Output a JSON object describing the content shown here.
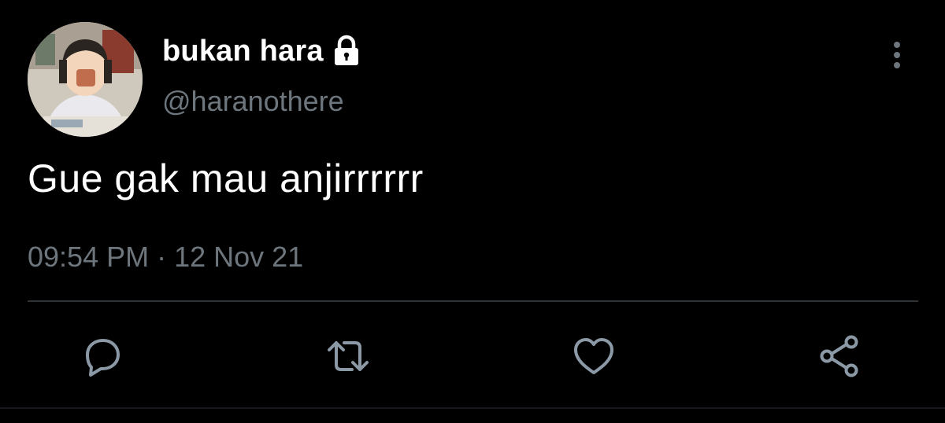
{
  "user": {
    "display_name": "bukan hara",
    "handle": "@haranothere"
  },
  "tweet": {
    "text": "Gue gak mau anjirrrrrr",
    "time": "09:54 PM",
    "separator": "·",
    "date": "12 Nov 21"
  },
  "icons": {
    "lock": "lock-icon",
    "more": "more-vertical-icon",
    "reply": "reply-icon",
    "retweet": "retweet-icon",
    "like": "heart-icon",
    "share": "share-icon"
  },
  "colors": {
    "background": "#000000",
    "primary_text": "#ffffff",
    "secondary_text": "#6e767d",
    "divider": "#2f3336"
  }
}
